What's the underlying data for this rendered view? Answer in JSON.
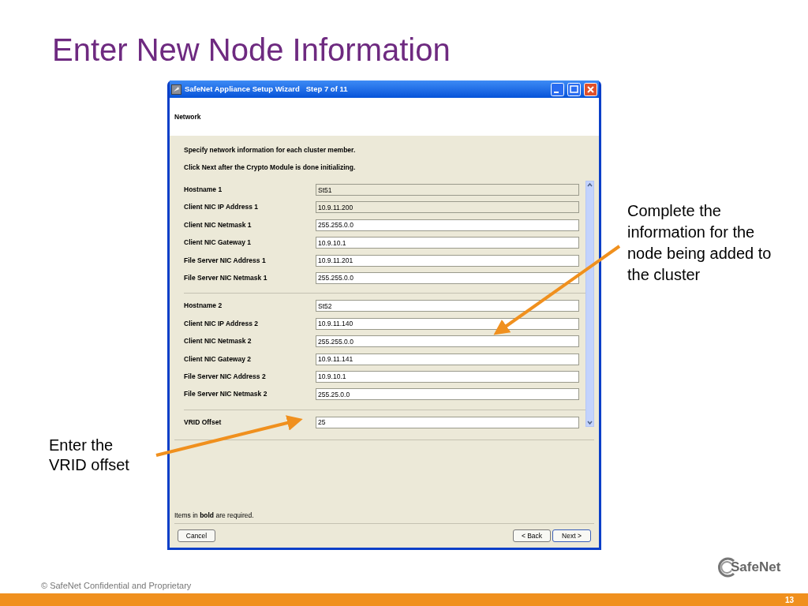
{
  "slide_title": "Enter New Node Information",
  "window": {
    "title": "SafeNet Appliance Setup Wizard   Step 7 of 11",
    "header": "Network",
    "instructions": [
      "Specify network information for each cluster member.",
      "Click Next after the Crypto Module is done initializing."
    ],
    "groups": [
      {
        "fields": [
          {
            "label": "Hostname 1",
            "value": "St51",
            "disabled": true
          },
          {
            "label": "Client NIC IP Address 1",
            "value": "10.9.11.200",
            "disabled": true
          },
          {
            "label": "Client NIC Netmask 1",
            "value": "255.255.0.0",
            "disabled": false
          },
          {
            "label": "Client NIC Gateway 1",
            "value": "10.9.10.1",
            "disabled": false
          },
          {
            "label": "File Server NIC Address 1",
            "value": "10.9.11.201",
            "disabled": false
          },
          {
            "label": "File Server NIC Netmask 1",
            "value": "255.255.0.0",
            "disabled": false
          }
        ]
      },
      {
        "fields": [
          {
            "label": "Hostname 2",
            "value": "St52",
            "disabled": false
          },
          {
            "label": "Client NIC IP Address 2",
            "value": "10.9.11.140",
            "disabled": false
          },
          {
            "label": "Client NIC Netmask 2",
            "value": "255.255.0.0",
            "disabled": false
          },
          {
            "label": "Client NIC Gateway 2",
            "value": "10.9.11.141",
            "disabled": false
          },
          {
            "label": "File Server NIC Address 2",
            "value": "10.9.10.1",
            "disabled": false
          },
          {
            "label": "File Server NIC Netmask 2",
            "value": "255.25.0.0",
            "disabled": false
          }
        ]
      },
      {
        "fields": [
          {
            "label": "VRID Offset",
            "value": "25",
            "disabled": false
          }
        ]
      }
    ],
    "note": "Items in **bold** are required.",
    "buttons": {
      "cancel": "Cancel",
      "back": "< Back",
      "next": "Next >"
    }
  },
  "callouts": {
    "right": "Complete the information for the node being added to the cluster",
    "left": "Enter the VRID offset"
  },
  "footer": {
    "copyright": "© SafeNet Confidential and Proprietary",
    "logo": "SafeNet",
    "page_number": "13"
  }
}
